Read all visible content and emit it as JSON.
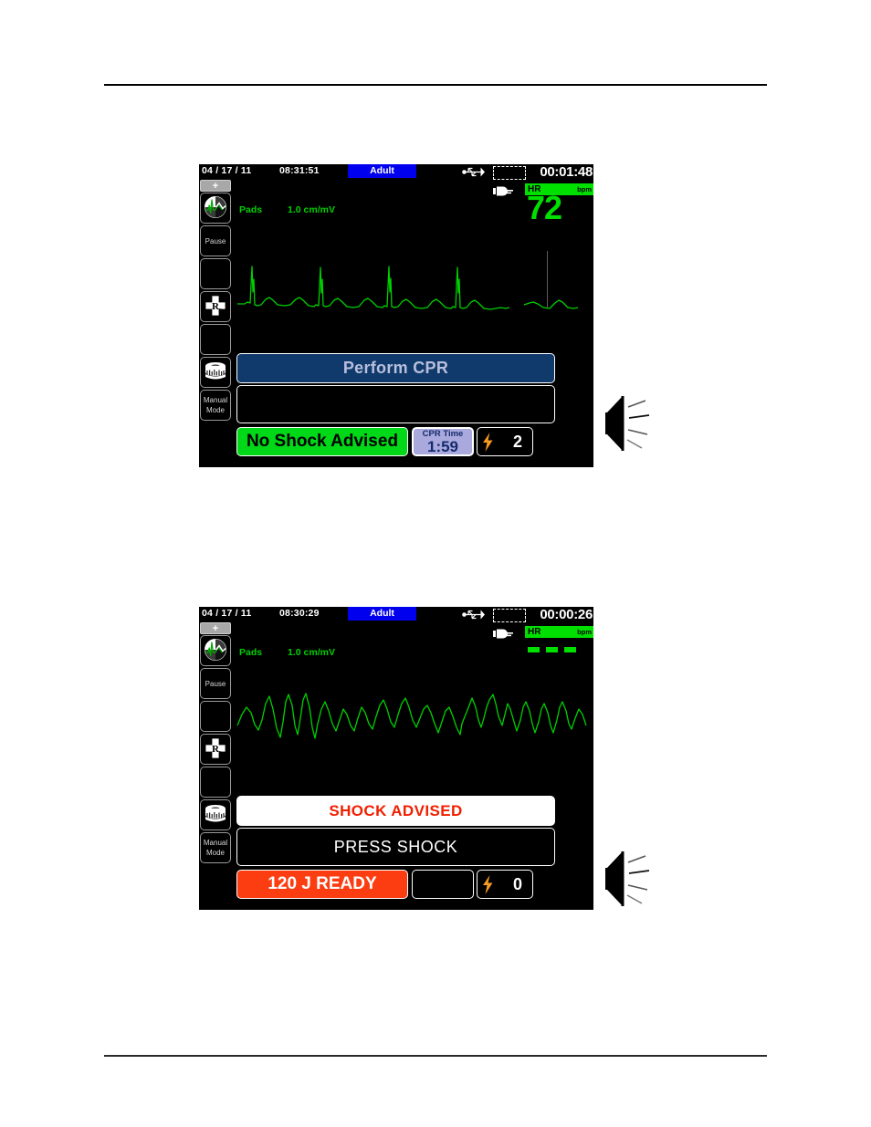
{
  "document": {
    "has_header_rule": true,
    "has_footer_rule": true
  },
  "colors": {
    "screen_background": "#000000",
    "ecg_green": "#00d000",
    "hr_green": "#00e000",
    "mode_badge_blue": "#0000ee",
    "cpr_banner_navy": "#103a6b",
    "cpr_banner_text": "#b9bfdd",
    "no_shock_green": "#00d818",
    "shock_ready_orange": "#fc3d11",
    "shock_advised_red": "#f02000",
    "cpr_timer_lavender": "#aaa9dd",
    "cpr_timer_text": "#152b6e",
    "bolt_orange": "#f59a22",
    "sidebar_border": "#9a9a9a"
  },
  "screens": [
    {
      "id": "screen-no-shock-advised",
      "statusbar": {
        "date": "04 / 17 / 11",
        "time": "08:31:51",
        "patient_mode": "Adult",
        "elapsed_time": "00:01:48",
        "icons": [
          "usb-icon",
          "battery-icon",
          "ac-plug-icon"
        ]
      },
      "sidebar": [
        {
          "name": "add-button",
          "label": "+"
        },
        {
          "name": "ecg-display-button",
          "label": "",
          "icon": "ecg-waveform-icon"
        },
        {
          "name": "pause-button",
          "label": "Pause"
        },
        {
          "name": "blank-button-1",
          "label": ""
        },
        {
          "name": "drug-dose-button",
          "label": "",
          "icon": "rx-cross-icon"
        },
        {
          "name": "blank-button-2",
          "label": ""
        },
        {
          "name": "print-button",
          "label": "",
          "icon": "printer-roll-icon"
        },
        {
          "name": "manual-mode-button",
          "label_line1": "Manual",
          "label_line2": "Mode"
        },
        {
          "name": "blank-button-3",
          "label": ""
        }
      ],
      "waveform": {
        "lead_label": "Pads",
        "gain_label": "1.0 cm/mV",
        "rhythm": "normal-sinus-rhythm",
        "has_erase_bar": true
      },
      "vitals": {
        "hr_label": "HR",
        "hr_unit": "bpm",
        "hr_value": "72",
        "hr_is_dashes": false
      },
      "banners": {
        "primary": "Perform CPR",
        "primary_style": "cpr",
        "secondary": "",
        "secondary_style": "empty"
      },
      "bottom": {
        "status_text": "No Shock Advised",
        "status_style": "no-shock",
        "cpr_timer_label": "CPR Time",
        "cpr_timer_value": "1:59",
        "cpr_timer_visible": true,
        "shock_count": "2"
      },
      "speaker_icon": "speaker-sound-icon"
    },
    {
      "id": "screen-shock-advised",
      "statusbar": {
        "date": "04 / 17 / 11",
        "time": "08:30:29",
        "patient_mode": "Adult",
        "elapsed_time": "00:00:26",
        "icons": [
          "usb-icon",
          "battery-icon",
          "ac-plug-icon"
        ]
      },
      "sidebar": [
        {
          "name": "add-button",
          "label": "+"
        },
        {
          "name": "ecg-display-button",
          "label": "",
          "icon": "ecg-waveform-icon"
        },
        {
          "name": "pause-button",
          "label": "Pause"
        },
        {
          "name": "blank-button-1",
          "label": ""
        },
        {
          "name": "drug-dose-button",
          "label": "",
          "icon": "rx-cross-icon"
        },
        {
          "name": "blank-button-2",
          "label": ""
        },
        {
          "name": "print-button",
          "label": "",
          "icon": "printer-roll-icon"
        },
        {
          "name": "manual-mode-button",
          "label_line1": "Manual",
          "label_line2": "Mode"
        },
        {
          "name": "blank-button-3",
          "label": ""
        }
      ],
      "waveform": {
        "lead_label": "Pads",
        "gain_label": "1.0 cm/mV",
        "rhythm": "ventricular-fibrillation",
        "has_erase_bar": false
      },
      "vitals": {
        "hr_label": "HR",
        "hr_unit": "bpm",
        "hr_value": "- - -",
        "hr_is_dashes": true
      },
      "banners": {
        "primary": "SHOCK ADVISED",
        "primary_style": "shock-advised",
        "secondary": "PRESS SHOCK",
        "secondary_style": "press-shock"
      },
      "bottom": {
        "status_energy": "120",
        "status_suffix": "J READY",
        "status_text": "120 J READY",
        "status_style": "ready",
        "cpr_timer_label": "",
        "cpr_timer_value": "",
        "cpr_timer_visible": false,
        "shock_count": "0"
      },
      "speaker_icon": "speaker-sound-icon"
    }
  ]
}
